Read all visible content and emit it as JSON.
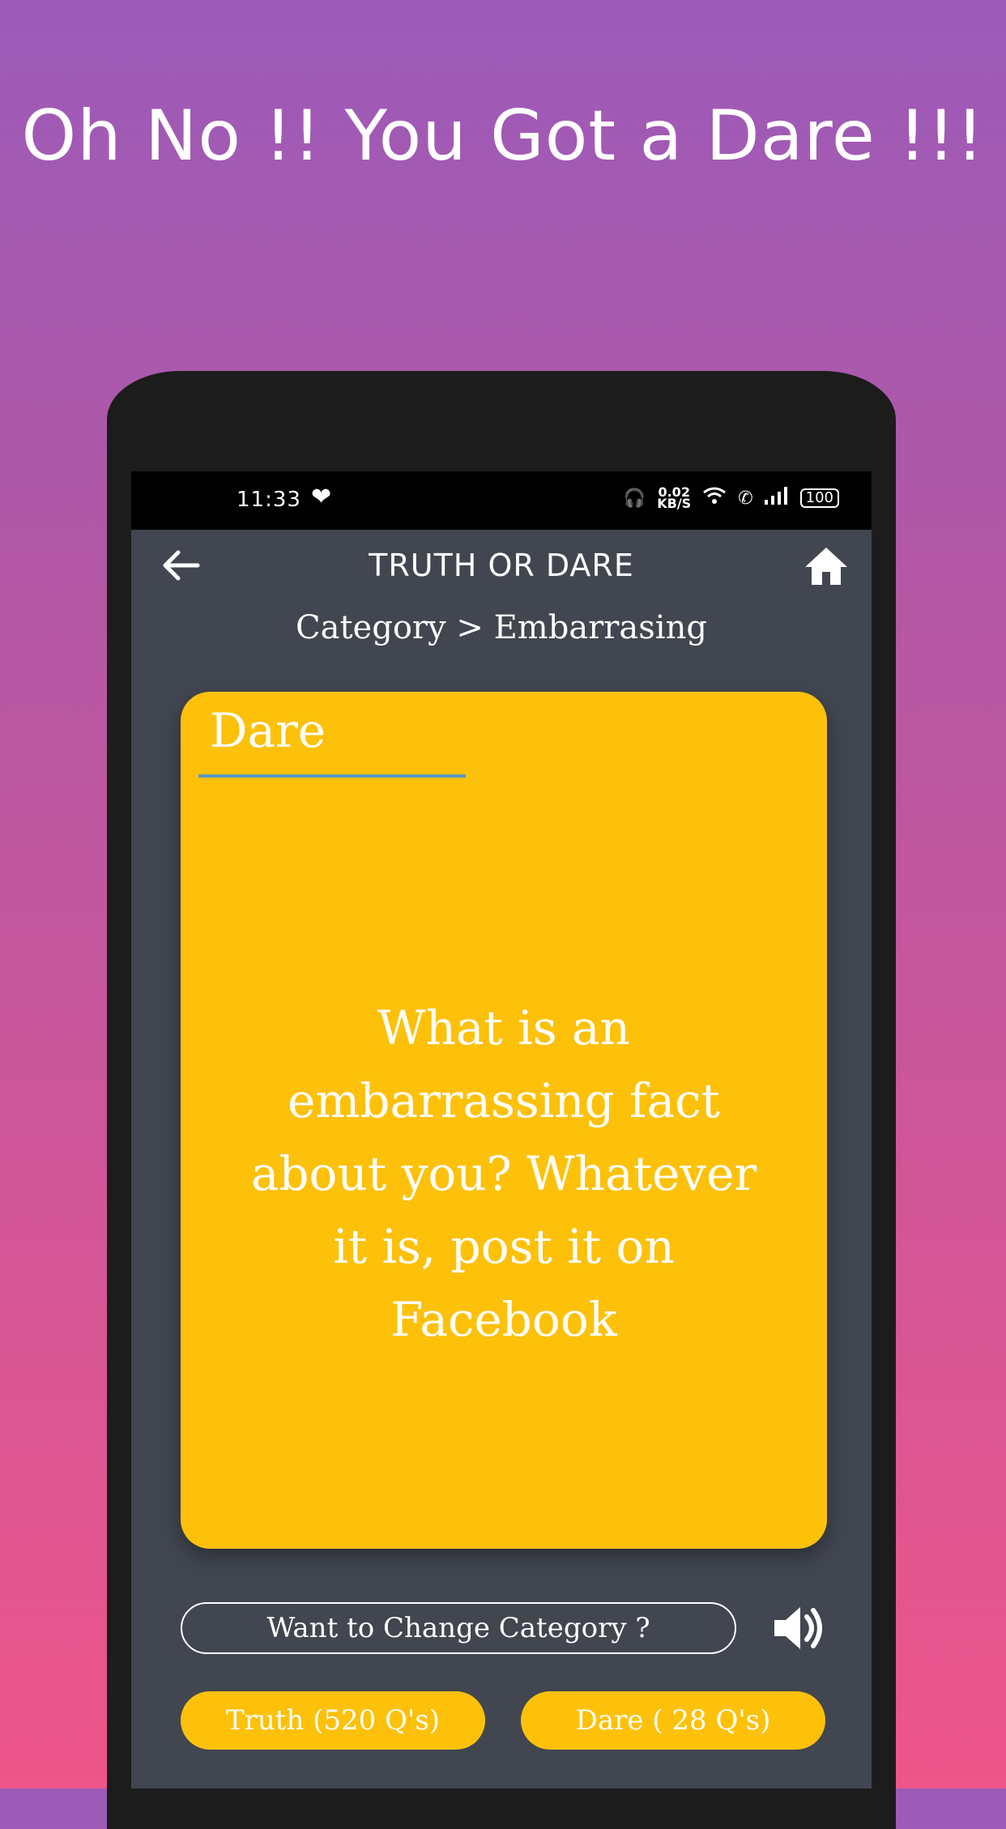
{
  "promo": {
    "headline": "Oh No !! You Got a Dare !!!"
  },
  "statusbar": {
    "time": "11:33",
    "speed_value": "0.02",
    "speed_unit": "KB/S",
    "battery": "100"
  },
  "appbar": {
    "title": "TRUTH OR DARE",
    "back_icon": "arrow-left-icon",
    "home_icon": "home-icon"
  },
  "breadcrumb": "Category > Embarrasing",
  "card": {
    "label": "Dare",
    "text": "What is an embarrassing fact about you? Whatever it is, post it on Facebook",
    "color": "#fdc10a"
  },
  "actions": {
    "change_category": "Want to Change Category ?",
    "sound_icon": "speaker-icon",
    "truth_button": "Truth (520 Q's)",
    "dare_button": "Dare ( 28 Q's)"
  }
}
